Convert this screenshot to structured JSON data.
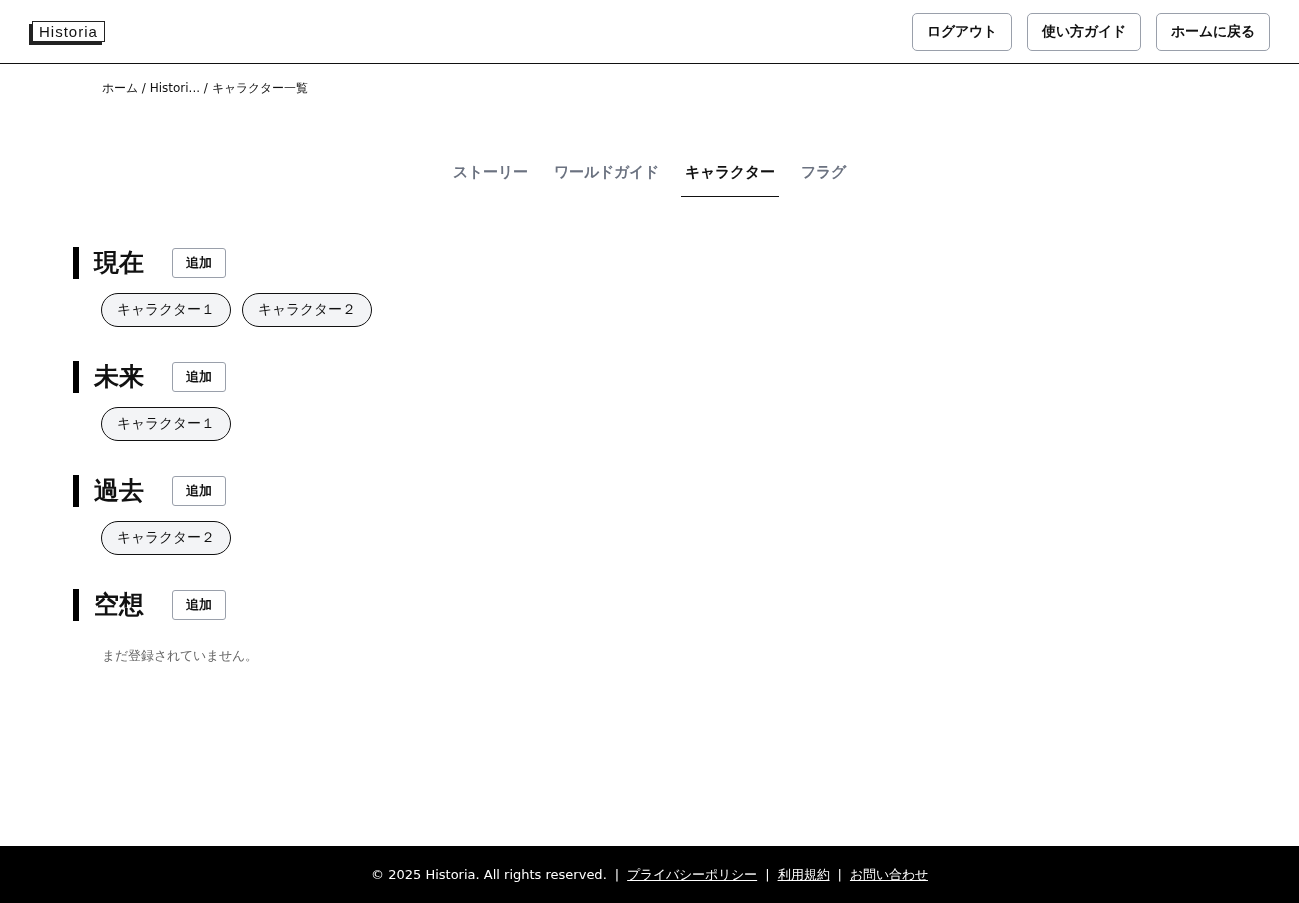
{
  "header": {
    "logo": "Historia",
    "buttons": [
      "ログアウト",
      "使い方ガイド",
      "ホームに戻る"
    ]
  },
  "breadcrumb": "ホーム / Histori... / キャラクター一覧",
  "tabs": [
    {
      "label": "ストーリー",
      "selected": false
    },
    {
      "label": "ワールドガイド",
      "selected": false
    },
    {
      "label": "キャラクター",
      "selected": true
    },
    {
      "label": "フラグ",
      "selected": false
    }
  ],
  "sections": [
    {
      "title": "現在",
      "add_button": "追加",
      "characters": [
        "キャラクター１",
        "キャラクター２"
      ]
    },
    {
      "title": "未来",
      "add_button": "追加",
      "characters": [
        "キャラクター１"
      ]
    },
    {
      "title": "過去",
      "add_button": "追加",
      "characters": [
        "キャラクター２"
      ]
    },
    {
      "title": "空想",
      "add_button": "追加",
      "empty_message": "まだ登録されていません。"
    }
  ],
  "footer": {
    "copyright": "© 2025 Historia. All rights reserved.",
    "links": [
      "プライバシーポリシー",
      "利用規約",
      "お問い合わせ"
    ],
    "separator": "|"
  }
}
